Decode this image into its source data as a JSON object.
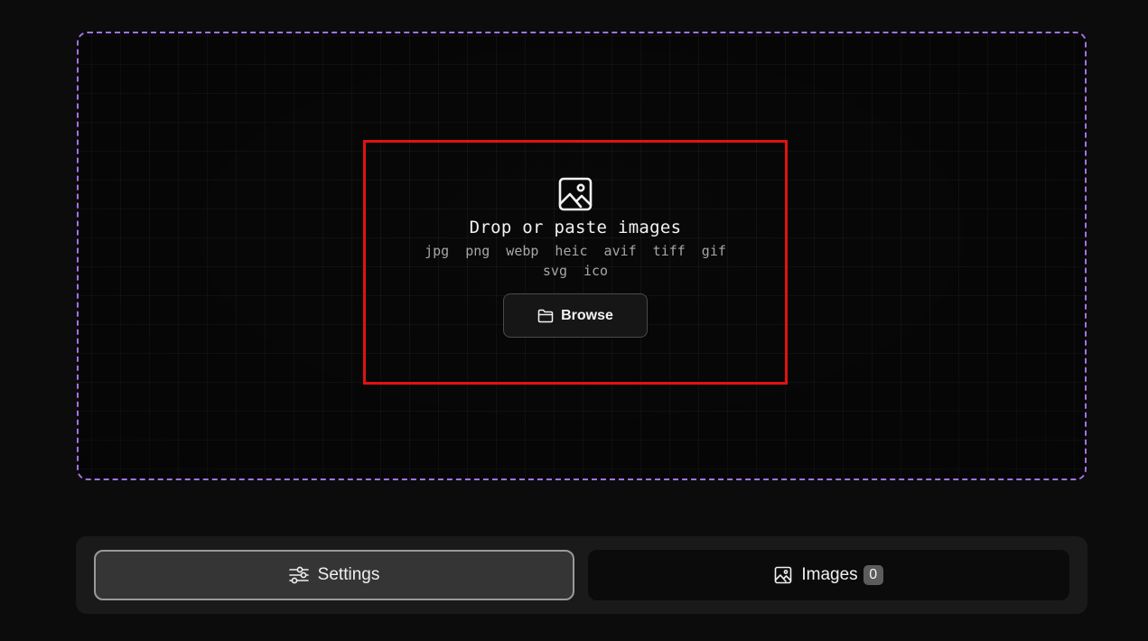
{
  "dropzone": {
    "title": "Drop or paste images",
    "formats": [
      "jpg",
      "png",
      "webp",
      "heic",
      "avif",
      "tiff",
      "gif",
      "svg",
      "ico"
    ],
    "browse_label": "Browse",
    "border_color": "#a173e6"
  },
  "bottom_bar": {
    "tabs": [
      {
        "label": "Settings",
        "icon": "sliders-icon",
        "active": true
      },
      {
        "label": "Images",
        "icon": "image-icon",
        "count": "0",
        "active": false
      }
    ]
  }
}
